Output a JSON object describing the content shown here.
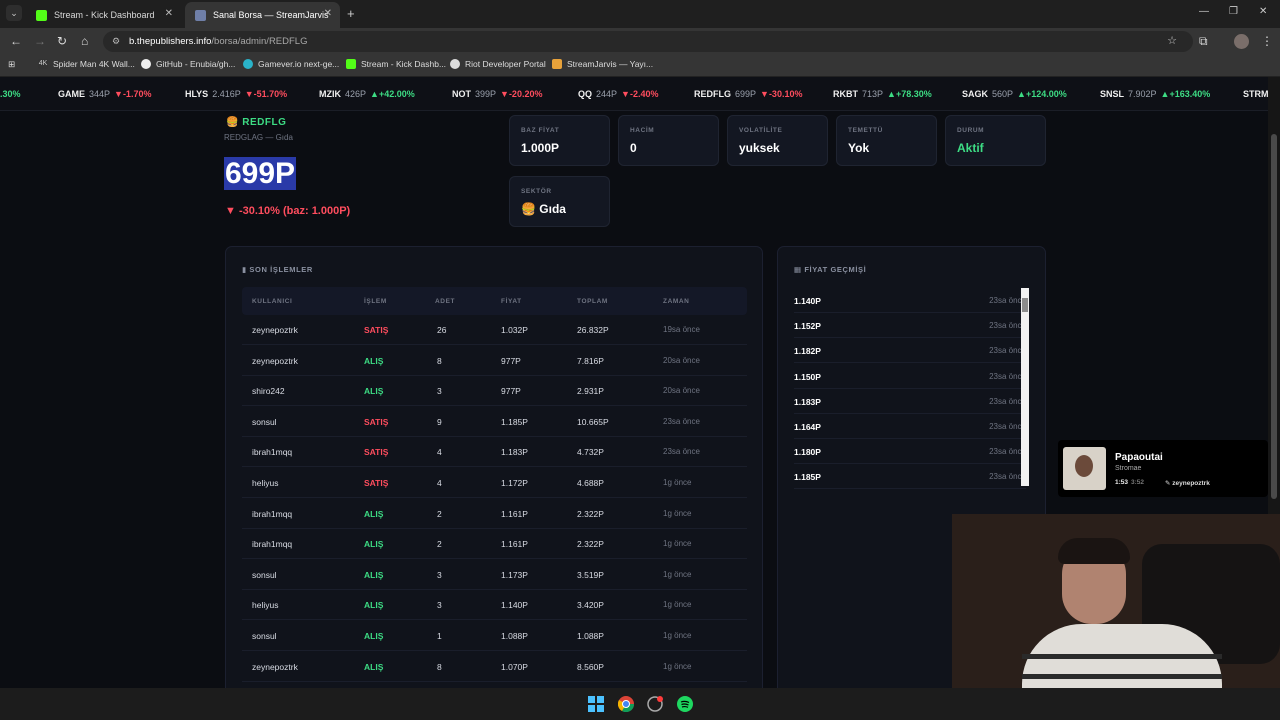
{
  "browser": {
    "tabs": [
      {
        "label": "Stream - Kick Dashboard",
        "close": "✕"
      },
      {
        "label": "Sanal Borsa — StreamJarvis",
        "close": "✕"
      }
    ],
    "new_tab": "+",
    "url_host": "b.thepublishers.info",
    "url_path": "/borsa/admin/REDFLG",
    "bookmarks": [
      "Spider Man 4K Wall...",
      "GitHub - Enubia/gh...",
      "Gamever.io next-ge...",
      "Stream - Kick Dashb...",
      "Riot Developer Portal",
      "StreamJarvis — Yayı..."
    ]
  },
  "ticker": [
    {
      "sym": "",
      "price": "",
      "chg": ".30%",
      "dir": "up"
    },
    {
      "sym": "GAME",
      "price": "344P",
      "chg": "▼-1.70%",
      "dir": "dn"
    },
    {
      "sym": "HLYS",
      "price": "2.416P",
      "chg": "▼-51.70%",
      "dir": "dn"
    },
    {
      "sym": "MZIK",
      "price": "426P",
      "chg": "▲+42.00%",
      "dir": "up"
    },
    {
      "sym": "NOT",
      "price": "399P",
      "chg": "▼-20.20%",
      "dir": "dn"
    },
    {
      "sym": "QQ",
      "price": "244P",
      "chg": "▼-2.40%",
      "dir": "dn"
    },
    {
      "sym": "REDFLG",
      "price": "699P",
      "chg": "▼-30.10%",
      "dir": "dn"
    },
    {
      "sym": "RKBT",
      "price": "713P",
      "chg": "▲+78.30%",
      "dir": "up"
    },
    {
      "sym": "SAGK",
      "price": "560P",
      "chg": "▲+124.00%",
      "dir": "up"
    },
    {
      "sym": "SNSL",
      "price": "7.902P",
      "chg": "▲+163.40%",
      "dir": "up"
    },
    {
      "sym": "STRM",
      "price": "",
      "chg": "",
      "dir": "up"
    }
  ],
  "stock": {
    "symbol": "REDFLG",
    "subtitle": "REDGLAG — Gıda",
    "price": "699P",
    "change": "▼ -30.10% (baz: 1.000P)"
  },
  "stats": [
    {
      "label": "BAZ FİYAT",
      "value": "1.000P",
      "color": "#ffffff"
    },
    {
      "label": "HACİM",
      "value": "0",
      "color": "#ffffff"
    },
    {
      "label": "VOLATİLİTE",
      "value": "yuksek",
      "color": "#ffffff"
    },
    {
      "label": "TEMETTÜ",
      "value": "Yok",
      "color": "#ffffff"
    },
    {
      "label": "DURUM",
      "value": "Aktif",
      "color": "#3ddc84"
    },
    {
      "label": "SEKTÖR",
      "value": "🍔 Gıda",
      "color": "#ffffff"
    }
  ],
  "trades": {
    "title": "SON İŞLEMLER",
    "columns": [
      "KULLANICI",
      "İŞLEM",
      "ADET",
      "FİYAT",
      "TOPLAM",
      "ZAMAN"
    ],
    "rows": [
      {
        "user": "zeynepoztrk",
        "type": "SATIŞ",
        "qty": "26",
        "price": "1.032P",
        "total": "26.832P",
        "time": "19sa önce"
      },
      {
        "user": "zeynepoztrk",
        "type": "ALIŞ",
        "qty": "8",
        "price": "977P",
        "total": "7.816P",
        "time": "20sa önce"
      },
      {
        "user": "shiro242",
        "type": "ALIŞ",
        "qty": "3",
        "price": "977P",
        "total": "2.931P",
        "time": "20sa önce"
      },
      {
        "user": "sonsul",
        "type": "SATIŞ",
        "qty": "9",
        "price": "1.185P",
        "total": "10.665P",
        "time": "23sa önce"
      },
      {
        "user": "ibrah1mqq",
        "type": "SATIŞ",
        "qty": "4",
        "price": "1.183P",
        "total": "4.732P",
        "time": "23sa önce"
      },
      {
        "user": "heliyus",
        "type": "SATIŞ",
        "qty": "4",
        "price": "1.172P",
        "total": "4.688P",
        "time": "1g önce"
      },
      {
        "user": "ibrah1mqq",
        "type": "ALIŞ",
        "qty": "2",
        "price": "1.161P",
        "total": "2.322P",
        "time": "1g önce"
      },
      {
        "user": "ibrah1mqq",
        "type": "ALIŞ",
        "qty": "2",
        "price": "1.161P",
        "total": "2.322P",
        "time": "1g önce"
      },
      {
        "user": "sonsul",
        "type": "ALIŞ",
        "qty": "3",
        "price": "1.173P",
        "total": "3.519P",
        "time": "1g önce"
      },
      {
        "user": "heliyus",
        "type": "ALIŞ",
        "qty": "3",
        "price": "1.140P",
        "total": "3.420P",
        "time": "1g önce"
      },
      {
        "user": "sonsul",
        "type": "ALIŞ",
        "qty": "1",
        "price": "1.088P",
        "total": "1.088P",
        "time": "1g önce"
      },
      {
        "user": "zeynepoztrk",
        "type": "ALIŞ",
        "qty": "8",
        "price": "1.070P",
        "total": "8.560P",
        "time": "1g önce"
      }
    ]
  },
  "history": {
    "title": "FİYAT GEÇMİŞİ",
    "rows": [
      {
        "price": "1.140P",
        "time": "23sa önce"
      },
      {
        "price": "1.152P",
        "time": "23sa önce"
      },
      {
        "price": "1.182P",
        "time": "23sa önce"
      },
      {
        "price": "1.150P",
        "time": "23sa önce"
      },
      {
        "price": "1.183P",
        "time": "23sa önce"
      },
      {
        "price": "1.164P",
        "time": "23sa önce"
      },
      {
        "price": "1.180P",
        "time": "23sa önce"
      },
      {
        "price": "1.185P",
        "time": "23sa önce"
      }
    ]
  },
  "now_playing": {
    "title": "Papaoutai",
    "artist": "Stromae",
    "elapsed": "1:53",
    "duration": "3:52",
    "user": "zeynepoztrk"
  },
  "colors": {
    "up": "#3ddc84",
    "down": "#ff4d5e",
    "accent": "#3ddc84"
  }
}
